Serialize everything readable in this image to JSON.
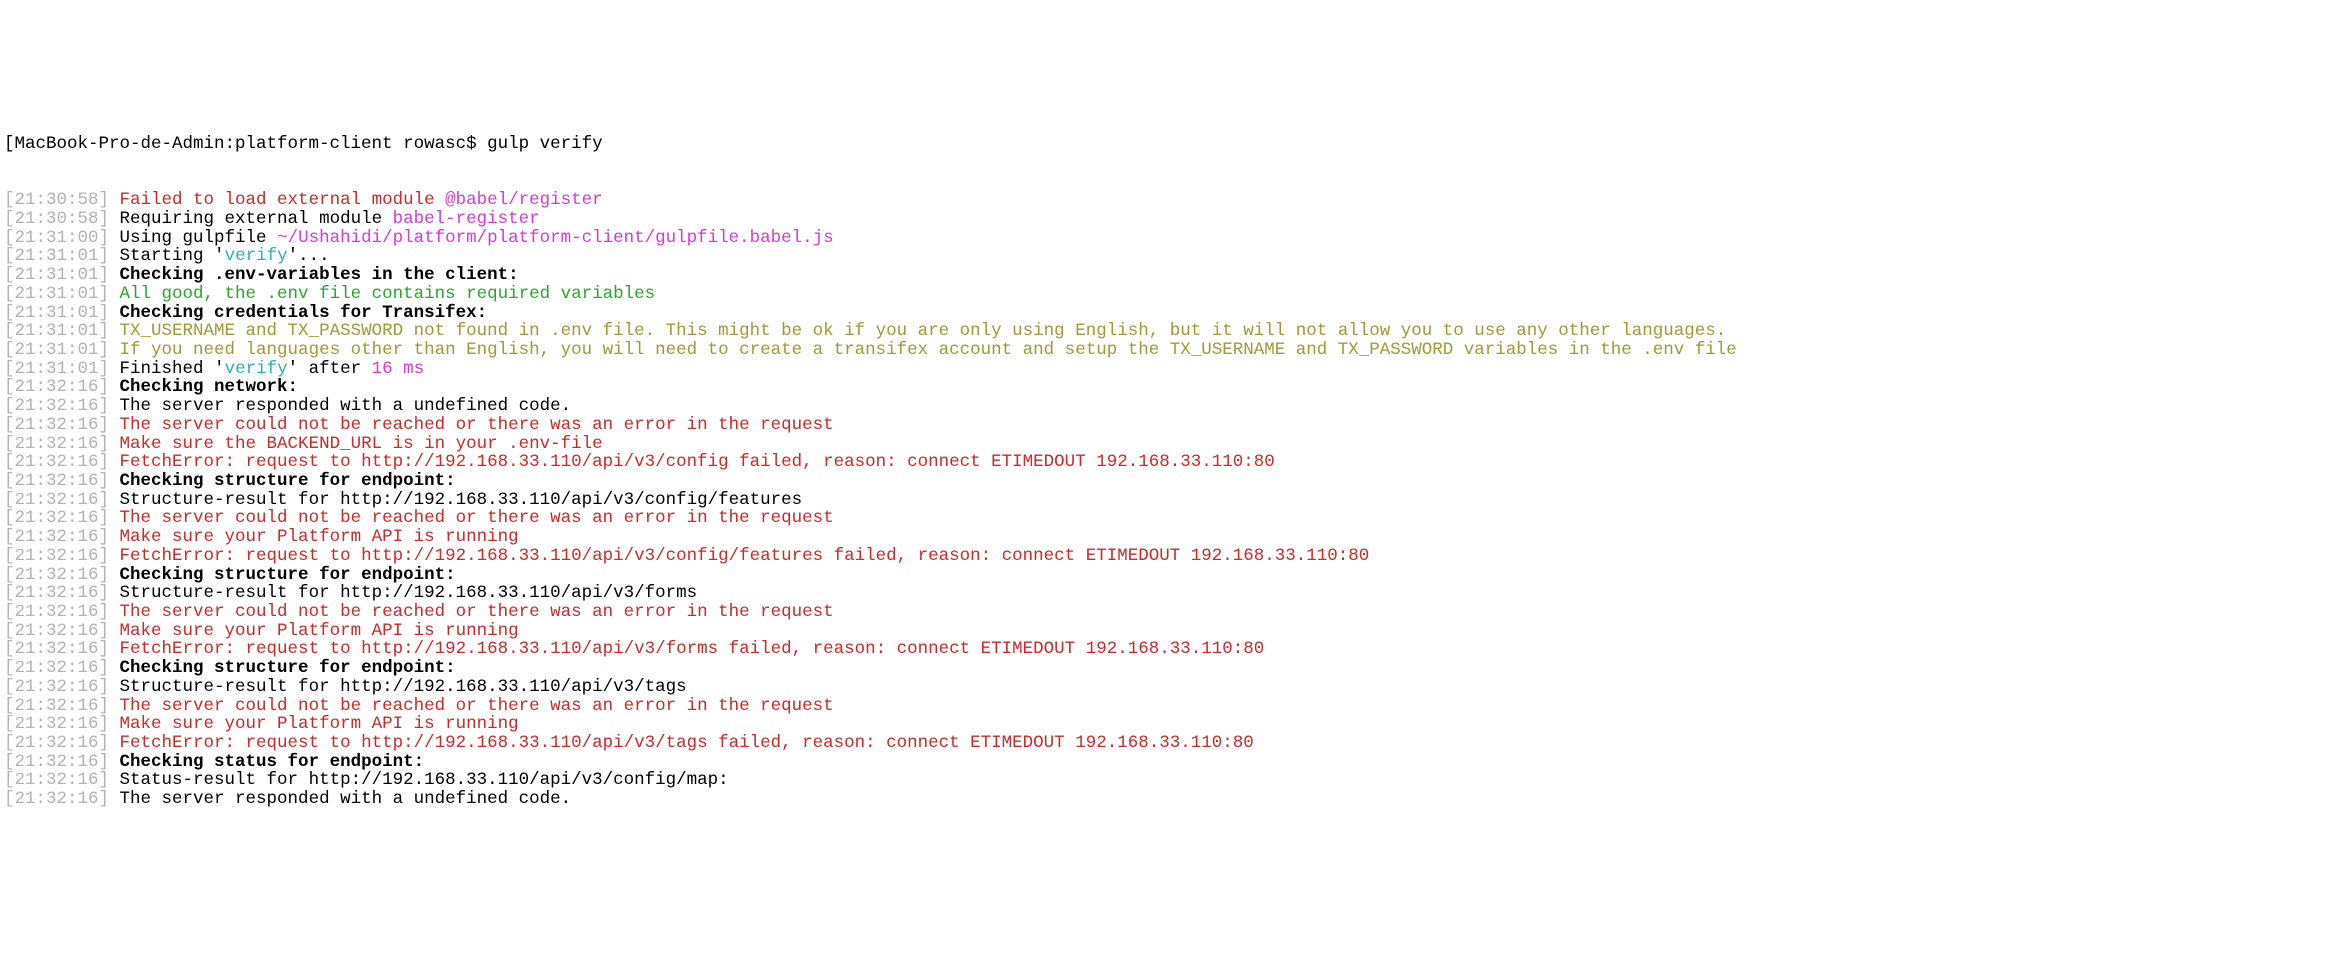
{
  "prompt_line": "[MacBook-Pro-de-Admin:platform-client rowasc$ gulp verify",
  "lines": [
    {
      "ts": "[21:30:58]",
      "segs": [
        {
          "cls": "red",
          "text": " Failed to load external module "
        },
        {
          "cls": "magenta",
          "text": "@babel/register"
        }
      ]
    },
    {
      "ts": "[21:30:58]",
      "segs": [
        {
          "cls": "plain",
          "text": " Requiring external module "
        },
        {
          "cls": "magenta",
          "text": "babel-register"
        }
      ]
    },
    {
      "ts": "[21:31:00]",
      "segs": [
        {
          "cls": "plain",
          "text": " Using gulpfile "
        },
        {
          "cls": "magenta",
          "text": "~/Ushahidi/platform/platform-client/gulpfile.babel.js"
        }
      ]
    },
    {
      "ts": "[21:31:01]",
      "segs": [
        {
          "cls": "plain",
          "text": " Starting '"
        },
        {
          "cls": "teal",
          "text": "verify"
        },
        {
          "cls": "plain",
          "text": "'..."
        }
      ]
    },
    {
      "ts": "[21:31:01]",
      "segs": [
        {
          "cls": "bold",
          "text": " Checking .env-variables in the client:"
        }
      ]
    },
    {
      "ts": "[21:31:01]",
      "segs": [
        {
          "cls": "green",
          "text": " All good, the .env file contains required variables"
        }
      ]
    },
    {
      "ts": "[21:31:01]",
      "segs": [
        {
          "cls": "bold",
          "text": " Checking credentials for Transifex:"
        }
      ]
    },
    {
      "ts": "[21:31:01]",
      "segs": [
        {
          "cls": "olive",
          "text": " TX_USERNAME and TX_PASSWORD not found in .env file. This might be ok if you are only using English, but it will not allow you to use any other languages."
        }
      ]
    },
    {
      "ts": "[21:31:01]",
      "segs": [
        {
          "cls": "olive",
          "text": " If you need languages other than English, you will need to create a transifex account and setup the TX_USERNAME and TX_PASSWORD variables in the .env file"
        }
      ]
    },
    {
      "ts": "[21:31:01]",
      "segs": [
        {
          "cls": "plain",
          "text": " Finished '"
        },
        {
          "cls": "teal",
          "text": "verify"
        },
        {
          "cls": "plain",
          "text": "' after "
        },
        {
          "cls": "magenta",
          "text": "16 ms"
        }
      ]
    },
    {
      "ts": "[21:32:16]",
      "segs": [
        {
          "cls": "bold",
          "text": " Checking network:"
        }
      ]
    },
    {
      "ts": "[21:32:16]",
      "segs": [
        {
          "cls": "plain",
          "text": " The server responded with a undefined code."
        }
      ]
    },
    {
      "ts": "[21:32:16]",
      "segs": [
        {
          "cls": "red",
          "text": " The server could not be reached or there was an error in the request"
        }
      ]
    },
    {
      "ts": "[21:32:16]",
      "segs": [
        {
          "cls": "red",
          "text": " Make sure the BACKEND_URL is in your .env-file"
        }
      ]
    },
    {
      "ts": "[21:32:16]",
      "segs": [
        {
          "cls": "red",
          "text": " FetchError: request to http://192.168.33.110/api/v3/config failed, reason: connect ETIMEDOUT 192.168.33.110:80"
        }
      ]
    },
    {
      "ts": "[21:32:16]",
      "segs": [
        {
          "cls": "bold",
          "text": " Checking structure for endpoint:"
        }
      ]
    },
    {
      "ts": "[21:32:16]",
      "segs": [
        {
          "cls": "plain",
          "text": " Structure-result for http://192.168.33.110/api/v3/config/features"
        }
      ]
    },
    {
      "ts": "[21:32:16]",
      "segs": [
        {
          "cls": "red",
          "text": " The server could not be reached or there was an error in the request"
        }
      ]
    },
    {
      "ts": "[21:32:16]",
      "segs": [
        {
          "cls": "red",
          "text": " Make sure your Platform API is running"
        }
      ]
    },
    {
      "ts": "[21:32:16]",
      "segs": [
        {
          "cls": "red",
          "text": " FetchError: request to http://192.168.33.110/api/v3/config/features failed, reason: connect ETIMEDOUT 192.168.33.110:80"
        }
      ]
    },
    {
      "ts": "[21:32:16]",
      "segs": [
        {
          "cls": "bold",
          "text": " Checking structure for endpoint:"
        }
      ]
    },
    {
      "ts": "[21:32:16]",
      "segs": [
        {
          "cls": "plain",
          "text": " Structure-result for http://192.168.33.110/api/v3/forms"
        }
      ]
    },
    {
      "ts": "[21:32:16]",
      "segs": [
        {
          "cls": "red",
          "text": " The server could not be reached or there was an error in the request"
        }
      ]
    },
    {
      "ts": "[21:32:16]",
      "segs": [
        {
          "cls": "red",
          "text": " Make sure your Platform API is running"
        }
      ]
    },
    {
      "ts": "[21:32:16]",
      "segs": [
        {
          "cls": "red",
          "text": " FetchError: request to http://192.168.33.110/api/v3/forms failed, reason: connect ETIMEDOUT 192.168.33.110:80"
        }
      ]
    },
    {
      "ts": "[21:32:16]",
      "segs": [
        {
          "cls": "bold",
          "text": " Checking structure for endpoint:"
        }
      ]
    },
    {
      "ts": "[21:32:16]",
      "segs": [
        {
          "cls": "plain",
          "text": " Structure-result for http://192.168.33.110/api/v3/tags"
        }
      ]
    },
    {
      "ts": "[21:32:16]",
      "segs": [
        {
          "cls": "red",
          "text": " The server could not be reached or there was an error in the request"
        }
      ]
    },
    {
      "ts": "[21:32:16]",
      "segs": [
        {
          "cls": "red",
          "text": " Make sure your Platform API is running"
        }
      ]
    },
    {
      "ts": "[21:32:16]",
      "segs": [
        {
          "cls": "red",
          "text": " FetchError: request to http://192.168.33.110/api/v3/tags failed, reason: connect ETIMEDOUT 192.168.33.110:80"
        }
      ]
    },
    {
      "ts": "[21:32:16]",
      "segs": [
        {
          "cls": "bold",
          "text": " Checking status for endpoint:"
        }
      ]
    },
    {
      "ts": "[21:32:16]",
      "segs": [
        {
          "cls": "plain",
          "text": " Status-result for http://192.168.33.110/api/v3/config/map:"
        }
      ]
    },
    {
      "ts": "[21:32:16]",
      "segs": [
        {
          "cls": "plain",
          "text": " The server responded with a undefined code."
        }
      ]
    }
  ]
}
